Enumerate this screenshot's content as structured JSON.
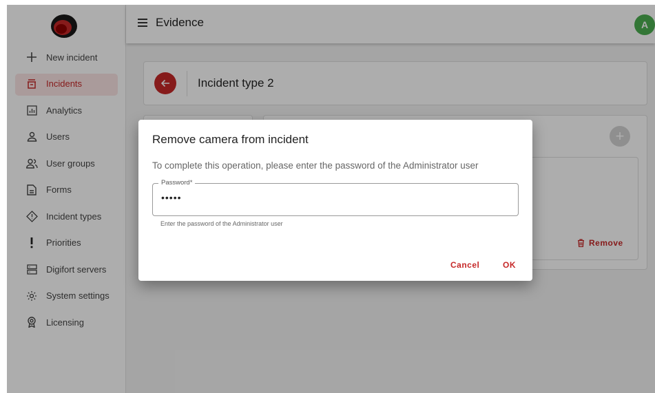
{
  "header": {
    "title": "Evidence",
    "avatar_initial": "A"
  },
  "sidebar": {
    "items": [
      {
        "label": "New incident",
        "icon": "plus-icon"
      },
      {
        "label": "Incidents",
        "icon": "incidents-icon",
        "active": true
      },
      {
        "label": "Analytics",
        "icon": "analytics-icon"
      },
      {
        "label": "Users",
        "icon": "user-icon"
      },
      {
        "label": "User groups",
        "icon": "user-groups-icon"
      },
      {
        "label": "Forms",
        "icon": "form-icon"
      },
      {
        "label": "Incident types",
        "icon": "incident-type-icon"
      },
      {
        "label": "Priorities",
        "icon": "exclamation-icon"
      },
      {
        "label": "Digifort servers",
        "icon": "server-icon"
      },
      {
        "label": "System settings",
        "icon": "gear-icon"
      },
      {
        "label": "Licensing",
        "icon": "license-icon"
      }
    ]
  },
  "content": {
    "title": "Incident type 2",
    "remove_label": "Remove"
  },
  "dialog": {
    "title": "Remove camera from incident",
    "message": "To complete this operation, please enter the password of the Administrator user",
    "password_label": "Password*",
    "password_value": "•••••",
    "hint": "Enter the password of the Administrator user",
    "cancel_label": "Cancel",
    "ok_label": "OK"
  },
  "colors": {
    "accent": "#c62828",
    "avatar": "#4caf50",
    "active_bg": "#fbe5e5"
  }
}
